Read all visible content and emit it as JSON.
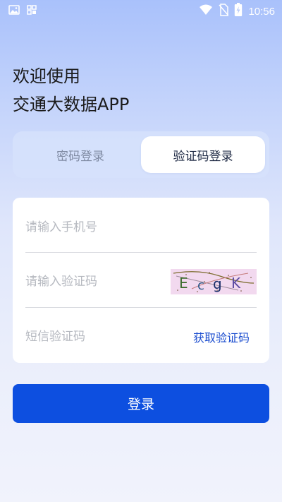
{
  "status_bar": {
    "time": "10:56",
    "icons": [
      "image-icon",
      "app-grid-icon",
      "wifi-icon",
      "no-sim-icon",
      "battery-charging-icon"
    ]
  },
  "header": {
    "line1": "欢迎使用",
    "line2": "交通大数据APP"
  },
  "tabs": {
    "password_login": "密码登录",
    "sms_login": "验证码登录",
    "active": "sms_login"
  },
  "form": {
    "phone": {
      "placeholder": "请输入手机号",
      "value": ""
    },
    "captcha": {
      "placeholder": "请输入验证码",
      "value": "",
      "image_text": "EcgK"
    },
    "sms_code": {
      "placeholder": "短信验证码",
      "value": "",
      "get_code_label": "获取验证码"
    }
  },
  "login_button": {
    "label": "登录"
  },
  "colors": {
    "primary": "#0D4FE0",
    "link": "#1A4CCF",
    "placeholder": "#B6B9C0"
  }
}
